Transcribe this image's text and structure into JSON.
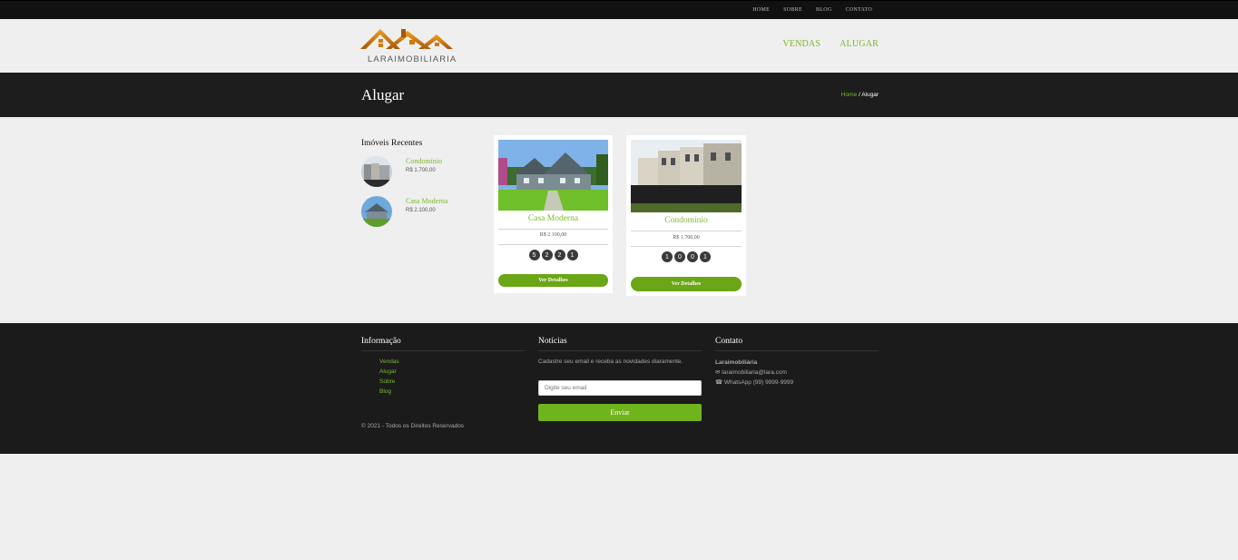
{
  "topbar": {
    "links": [
      "HOME",
      "SOBRE",
      "BLOG",
      "CONTATO"
    ]
  },
  "header": {
    "logo_text": "LARAIMOBILIARIA",
    "nav": [
      "VENDAS",
      "ALUGAR"
    ]
  },
  "pagebar": {
    "title": "Alugar",
    "breadcrumb_home": "Home",
    "breadcrumb_sep": " / ",
    "breadcrumb_current": "Alugar"
  },
  "sidebar": {
    "heading": "Imóveis Recentes",
    "items": [
      {
        "name": "Condomínio",
        "price": "R$ 1.700,00"
      },
      {
        "name": "Casa Moderna",
        "price": "R$ 2.100,00"
      }
    ]
  },
  "cards": [
    {
      "name": "Casa Moderna",
      "price": "R$ 2.100,00",
      "badges": [
        "5",
        "2",
        "2",
        "1"
      ],
      "button": "Ver Detalhes"
    },
    {
      "name": "Condomínio",
      "price": "R$ 1.700,00",
      "badges": [
        "1",
        "0",
        "0",
        "1"
      ],
      "button": "Ver Detalhes"
    }
  ],
  "footer": {
    "info": {
      "heading": "Informação",
      "links": [
        "Vendas",
        "Alugar",
        "Sobre",
        "Blog"
      ]
    },
    "news": {
      "heading": "Notícias",
      "text": "Cadastre seu email e receba as novidades diaramente.",
      "placeholder": "Digite seu email",
      "button": "Enviar"
    },
    "contact": {
      "heading": "Contato",
      "brand": "Laraimobiliária",
      "email": "laraimobiliaria@lara.com",
      "phone": "WhatsApp (99) 9999-9999"
    },
    "copyright": "© 2021 - Todos os Direitos Reservados"
  },
  "colors": {
    "accent": "#7cb82f",
    "button": "#6aa616",
    "dark": "#1d1d1d"
  }
}
